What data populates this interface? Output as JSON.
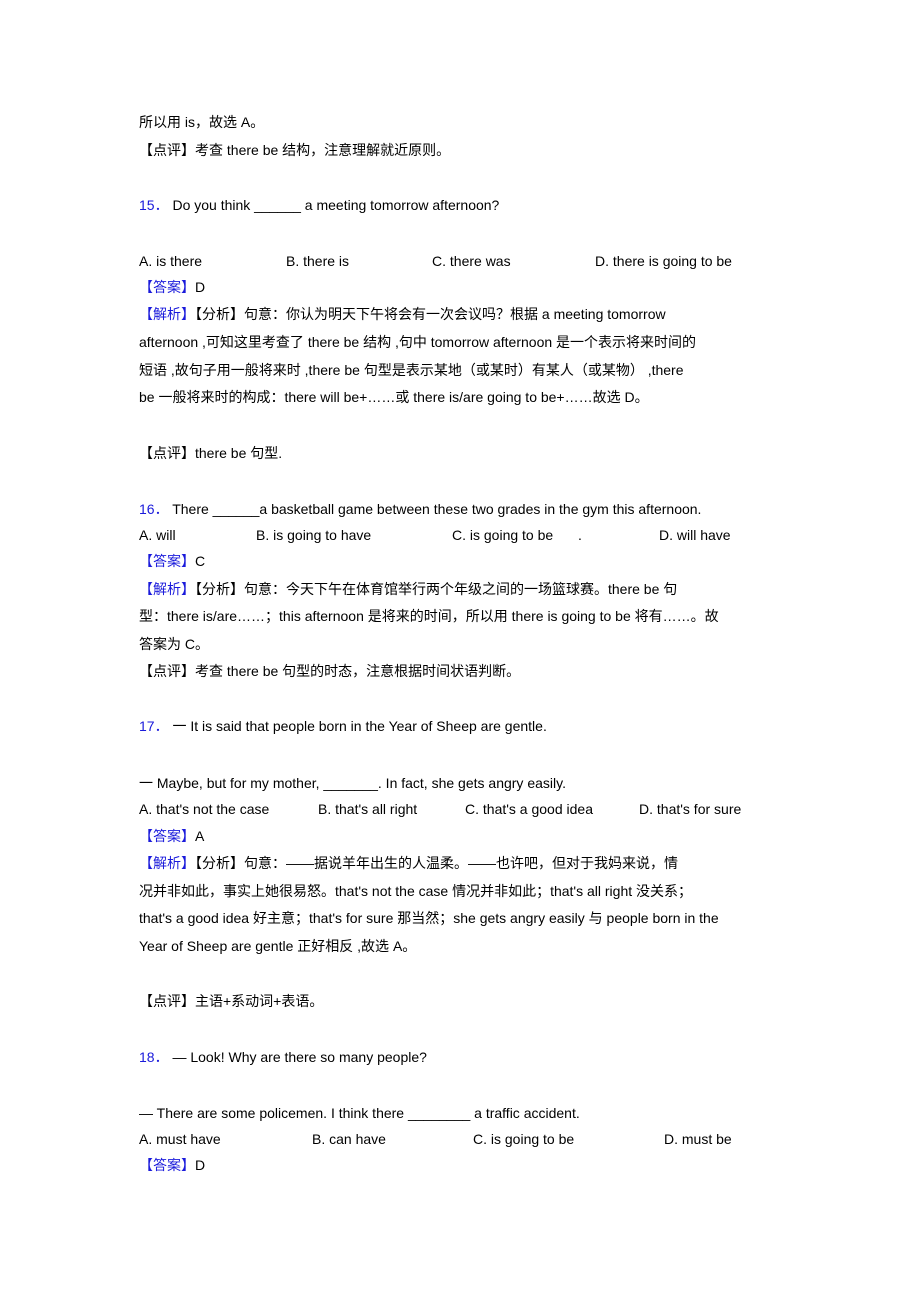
{
  "page": {
    "intro_lines": [
      "所以用 is，故选 A。",
      "【点评】考查 there be 结构，注意理解就近原则。"
    ],
    "labels": {
      "answer": "【答案】",
      "analysis": "【解析】",
      "comment": "【点评】"
    },
    "questions": [
      {
        "number": "15．",
        "stem": "Do you think ______ a meeting tomorrow afternoon?",
        "options": [
          "A. is there",
          "B. there is",
          "C. there was",
          "D. there is going to be"
        ],
        "answer": "D",
        "analysis_lines": [
          "【分析】句意：你认为明天下午将会有一次会议吗？根据 a meeting tomorrow",
          "afternoon ,可知这里考查了 there be 结构 ,句中 tomorrow afternoon 是一个表示将来时间的",
          "短语 ,故句子用一般将来时 ,there be 句型是表示某地（或某时）有某人（或某物） ,there",
          "be 一般将来时的构成：there will be+……或 there is/are going to be+……故选 D。"
        ],
        "comment": "there be 句型."
      },
      {
        "number": "16．",
        "stem": "There ______a basketball game between these two grades in the gym this afternoon.",
        "options": [
          "A. will",
          "B. is going to have",
          "C. is going to be",
          ".",
          "D. will have"
        ],
        "answer": "C",
        "analysis_lines": [
          "【分析】句意：今天下午在体育馆举行两个年级之间的一场篮球赛。there be 句",
          "型：there is/are……；this afternoon 是将来的时间，所以用 there is going to be 将有……。故",
          "答案为 C。"
        ],
        "comment": "考查 there be 句型的时态，注意根据时间状语判断。"
      },
      {
        "number": "17．",
        "stem": "一 It is said that people born in the Year of Sheep are gentle.",
        "stem2": "一 Maybe, but for my mother, _______. In fact, she gets angry easily.",
        "options": [
          "A. that's not the case",
          "B. that's all right",
          "C. that's a good idea",
          "D. that's for sure"
        ],
        "answer": "A",
        "analysis_lines": [
          "【分析】句意：——据说羊年出生的人温柔。——也许吧，但对于我妈来说，情",
          "况并非如此，事实上她很易怒。that's not the case 情况并非如此；that's all right 没关系；",
          "that's a good idea 好主意；that's for sure 那当然；she gets angry easily 与 people born in the",
          "Year of Sheep are gentle 正好相反 ,故选 A。"
        ],
        "comment": "主语+系动词+表语。"
      },
      {
        "number": "18．",
        "stem": "— Look! Why are there so many people?",
        "stem2": "— There are some policemen. I think there ________ a traffic accident.",
        "options": [
          "A. must have",
          "B. can have",
          "C. is going to be",
          "D. must be"
        ],
        "answer": "D"
      }
    ]
  }
}
